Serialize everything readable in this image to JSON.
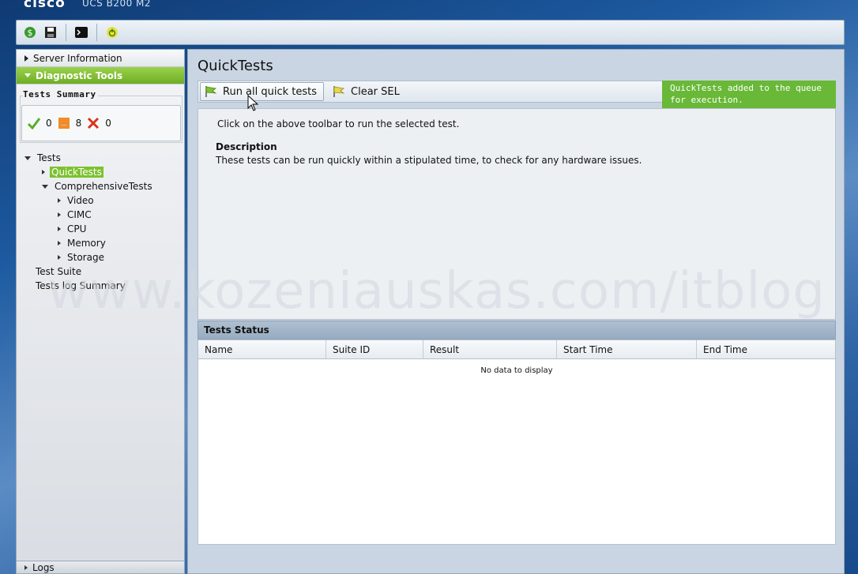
{
  "header": {
    "brand": "cisco",
    "model": "UCS B200 M2"
  },
  "toolbar": {
    "icons": [
      "refresh-icon",
      "save-icon",
      "console-icon",
      "power-icon"
    ]
  },
  "sidebar": {
    "server_information": "Server Information",
    "diagnostic_tools": "Diagnostic Tools",
    "tests_summary_label": "Tests Summary",
    "summary": {
      "passed": "0",
      "in_progress": "8",
      "failed": "0"
    },
    "tree": {
      "tests": "Tests",
      "quicktests": "QuickTests",
      "comprehensive": "ComprehensiveTests",
      "comprehensive_children": [
        "Video",
        "CIMC",
        "CPU",
        "Memory",
        "Storage"
      ],
      "test_suite": "Test Suite",
      "tests_log_summary": "Tests log Summary"
    },
    "logs": "Logs"
  },
  "main": {
    "title": "QuickTests",
    "run_all_label": "Run all quick tests",
    "clear_sel_label": "Clear SEL",
    "notification": "QuickTests added to the queue for execution.",
    "hint": "Click on the above toolbar to run the selected test.",
    "description_heading": "Description",
    "description_text": "These tests can be run quickly within a stipulated time, to check for any hardware issues.",
    "status_heading": "Tests Status",
    "columns": [
      "Name",
      "Suite ID",
      "Result",
      "Start Time",
      "End Time"
    ],
    "empty_text": "No data to display"
  },
  "watermark": "www.kozeniauskas.com/itblog",
  "colors": {
    "accent_green": "#7cc22f",
    "notice_green": "#69b838",
    "background_blue": "#1d5aa0"
  }
}
